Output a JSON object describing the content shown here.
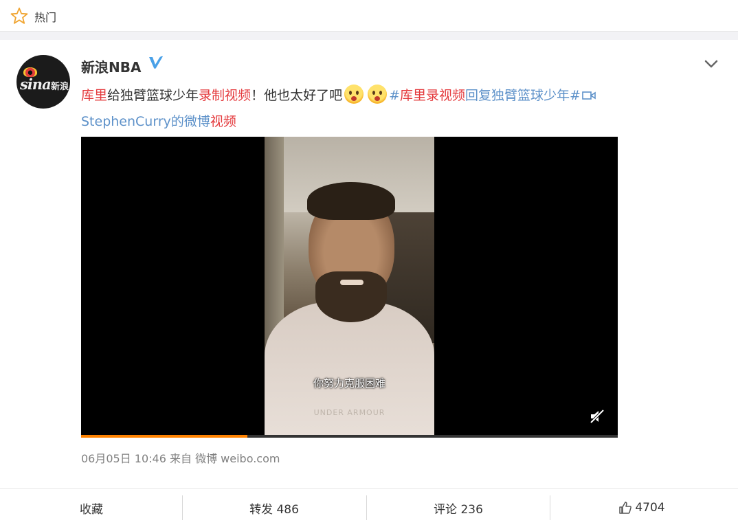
{
  "top_bar": {
    "label": "热门",
    "icon": "star-icon"
  },
  "post": {
    "username": "新浪NBA",
    "verified": true,
    "avatar_logo_text": "sina",
    "avatar_logo_cn": "新浪",
    "text": {
      "part1": "库里",
      "part2": "给独臂篮球少年",
      "part3": "录制",
      "part4": "视频",
      "part5": "！他也太好了吧",
      "tag_prefix": "#",
      "tag_highlight": "库里录视频",
      "tag_rest": "回复独臂篮球少年#",
      "link_name": "StephenCurry的微博",
      "link_video": "视频"
    },
    "video": {
      "subtitle": "你努力克服困难",
      "brand_text": "UNDER ARMOUR",
      "progress": 0.31
    },
    "meta": "06月05日 10:46  来自 微博 weibo.com"
  },
  "actions": {
    "favorite": "收藏",
    "repost": "转发 486",
    "comment": "评论 236",
    "like": "4704"
  },
  "colors": {
    "highlight": "#e4393c",
    "link": "#5d91c9",
    "progress": "#ff8200",
    "verified": "#4aa1e8"
  }
}
